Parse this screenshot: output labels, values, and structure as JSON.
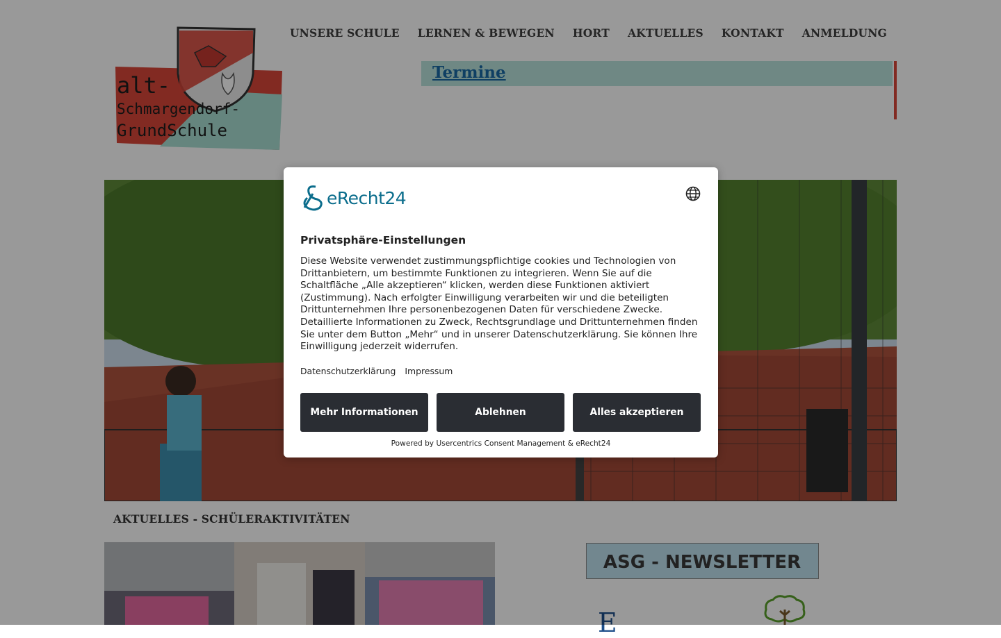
{
  "site": {
    "logo": {
      "line1": "alt-",
      "line2": "Schmargendorf-",
      "line3": "GrundSchule"
    },
    "nav": [
      "UNSERE SCHULE",
      "LERNEN & BEWEGEN",
      "HORT",
      "AKTUELLES",
      "KONTAKT",
      "ANMELDUNG"
    ],
    "termine_label": "Termine",
    "section_heading": "AKTUELLES - SCHÜLERAKTIVITÄTEN",
    "newsletter_text": "ASG - NEWSLETTER",
    "partial_letter": "E"
  },
  "consent": {
    "brand": "eRecht24",
    "title": "Privatsphäre-Einstellungen",
    "body": "Diese Website verwendet zustimmungspflichtige cookies und Technologien von Drittanbietern, um bestimmte Funktionen zu integrieren. Wenn Sie auf die Schaltfläche „Alle akzeptieren“ klicken, werden diese Funktionen aktiviert (Zustimmung). Nach erfolgter Einwilligung verarbeiten wir und die beteiligten Drittunternehmen Ihre personenbezogenen Daten für verschiedene Zwecke. Detaillierte Informationen zu Zweck, Rechtsgrundlage und Drittunternehmen finden Sie unter dem Button „Mehr“ und in unserer Datenschutzerklärung. Sie können Ihre Einwilligung jederzeit widerrufen.",
    "link_privacy": "Datenschutzerklärung",
    "link_imprint": "Impressum",
    "btn_more": "Mehr Informationen",
    "btn_deny": "Ablehnen",
    "btn_accept": "Alles akzeptieren",
    "powered_by": "Powered by Usercentrics Consent Management & eRecht24"
  },
  "colors": {
    "termine_bar": "#b9e3dc",
    "termine_edge": "#d9473a",
    "link": "#1a6aa5",
    "button_dark": "#2a2d33",
    "brand_teal": "#0b6d8c",
    "overlay": "rgba(0,0,0,0.40)"
  },
  "icons": [
    "school-crest-icon",
    "globe-icon",
    "erecht24-logo-icon",
    "tree-icon"
  ]
}
